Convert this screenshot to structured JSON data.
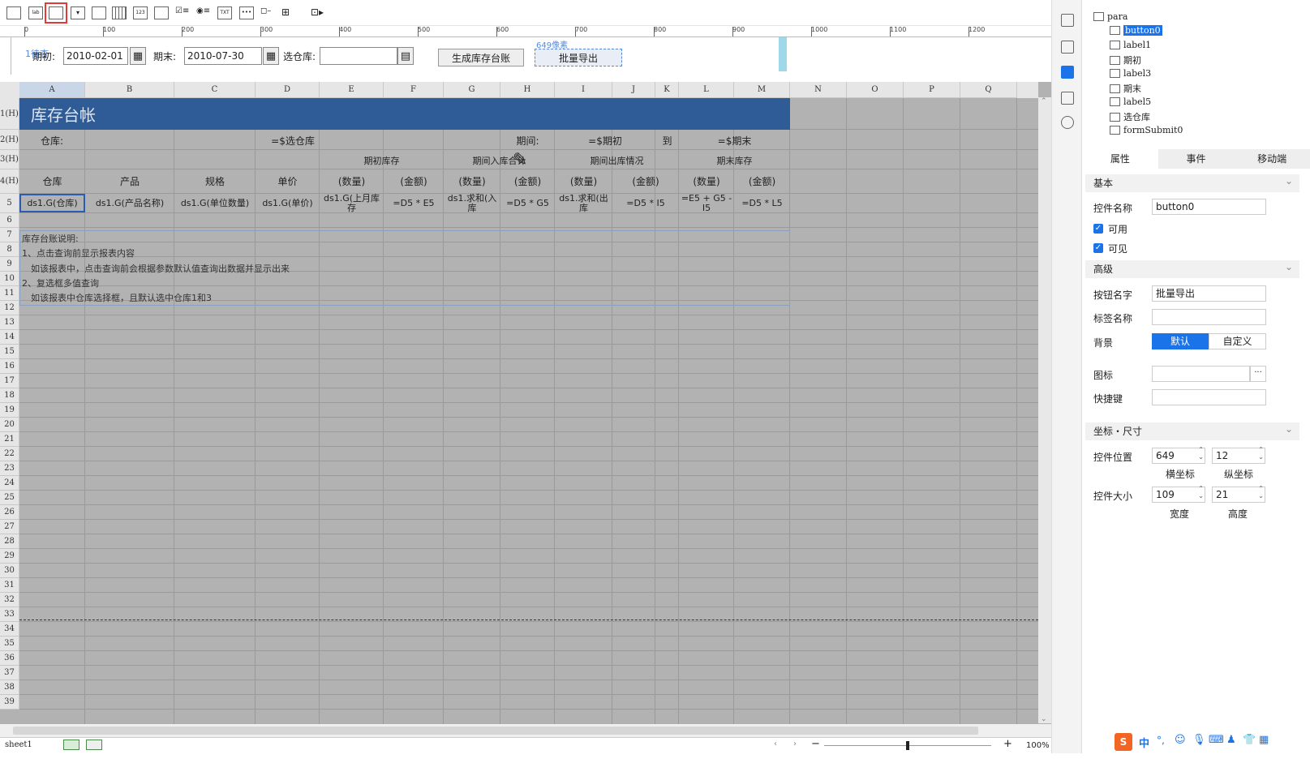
{
  "toolbar": {
    "items": [
      "textbox-icon",
      "label-icon",
      "button-icon",
      "dropdown-icon",
      "tree-icon",
      "date-icon",
      "number-icon",
      "list-icon",
      "checkbox-group-icon",
      "radio-group-icon",
      "textarea-icon",
      "password-icon",
      "tag-icon",
      "treetable-icon",
      "more-icon"
    ]
  },
  "param": {
    "hint_label": "1待查",
    "start_label": "期初:",
    "start_value": "2010-02-01",
    "end_label": "期末:",
    "end_value": "2010-07-30",
    "warehouse_label": "选仓库:",
    "warehouse_value": "",
    "gen_button": "生成库存台账",
    "export_button": "批量导出",
    "size_hint": "649像素"
  },
  "ruler": [
    "0",
    "100",
    "200",
    "300",
    "400",
    "500",
    "600",
    "700",
    "800",
    "900",
    "1000",
    "1100",
    "1200"
  ],
  "sheet": {
    "columns": [
      "A",
      "B",
      "C",
      "D",
      "E",
      "F",
      "G",
      "H",
      "I",
      "J",
      "K",
      "L",
      "M",
      "N",
      "O",
      "P",
      "Q"
    ],
    "row_labels": [
      "1(H)",
      "2(H)",
      "3(H)",
      "4(H)",
      "5",
      "6",
      "7",
      "8",
      "9",
      "10",
      "11",
      "12",
      "13",
      "14",
      "15",
      "16",
      "17",
      "18",
      "19",
      "20",
      "21",
      "22",
      "23",
      "24",
      "25",
      "26",
      "27",
      "28",
      "29",
      "30",
      "31",
      "32",
      "33",
      "34",
      "35",
      "36",
      "37",
      "38",
      "39"
    ],
    "title": "库存台帐",
    "row2": {
      "warehouse_label": "仓库:",
      "warehouse_value": "=$选仓库",
      "period_label": "期间:",
      "start": "=$期初",
      "to": "到",
      "end": "=$期末"
    },
    "row3": {
      "g1": "期初库存",
      "g2": "期间入库合计",
      "g3": "期间出库情况",
      "g4": "期末库存"
    },
    "row4": [
      "仓库",
      "产品",
      "规格",
      "单价",
      "(数量)",
      "(金额)",
      "(数量)",
      "(金额)",
      "(数量)",
      "(金额)",
      "(数量)",
      "(金额)"
    ],
    "row5": [
      "ds1.G(仓库)",
      "ds1.G(产品名称)",
      "ds1.G(单位数量)",
      "ds1.G(单价)",
      "ds1.G(上月库存",
      "=D5 * E5",
      "ds1.求和(入库",
      "=D5 * G5",
      "ds1.求和(出库",
      "=D5 * I5",
      "=E5 + G5 - I5",
      "=D5 * L5"
    ],
    "notes": [
      "库存台账说明:",
      "1、点击查询前显示报表内容",
      "　如该报表中，点击查询前会根据参数默认值查询出数据并显示出来",
      "2、复选框多值查询",
      "　如该报表中仓库选择框，且默认选中仓库1和3"
    ]
  },
  "status": {
    "sheet_tab": "sheet1",
    "zoom": "100%"
  },
  "tree": {
    "root": "para",
    "items": [
      {
        "name": "button0",
        "icon": "button-icon"
      },
      {
        "name": "label1",
        "icon": "label-icon"
      },
      {
        "name": "期初",
        "icon": "date-icon"
      },
      {
        "name": "label3",
        "icon": "label-icon"
      },
      {
        "name": "期末",
        "icon": "date-icon"
      },
      {
        "name": "label5",
        "icon": "label-icon"
      },
      {
        "name": "选仓库",
        "icon": "dropdown-icon"
      },
      {
        "name": "formSubmit0",
        "icon": "form-icon"
      }
    ]
  },
  "props": {
    "tabs": [
      "属性",
      "事件",
      "移动端"
    ],
    "basic_section": "基本",
    "name_label": "控件名称",
    "name_value": "button0",
    "enabled_label": "可用",
    "visible_label": "可见",
    "advanced_section": "高级",
    "btn_name_label": "按钮名字",
    "btn_name_value": "批量导出",
    "tag_label": "标签名称",
    "tag_value": "",
    "bg_label": "背景",
    "bg_default": "默认",
    "bg_custom": "自定义",
    "icon_label": "图标",
    "icon_more": "···",
    "shortcut_label": "快捷键",
    "geo_section": "坐标・尺寸",
    "pos_label": "控件位置",
    "pos_x": "649",
    "pos_y": "12",
    "pos_x_label": "横坐标",
    "pos_y_label": "纵坐标",
    "size_label": "控件大小",
    "width": "109",
    "height": "21",
    "width_label": "宽度",
    "height_label": "高度"
  },
  "taskbar": {
    "ime": "中",
    "punct": "°,"
  },
  "colors": {
    "title_bg": "#2f5b96",
    "accent": "#1a73e8",
    "sheet_bg": "#b2b2b2"
  }
}
